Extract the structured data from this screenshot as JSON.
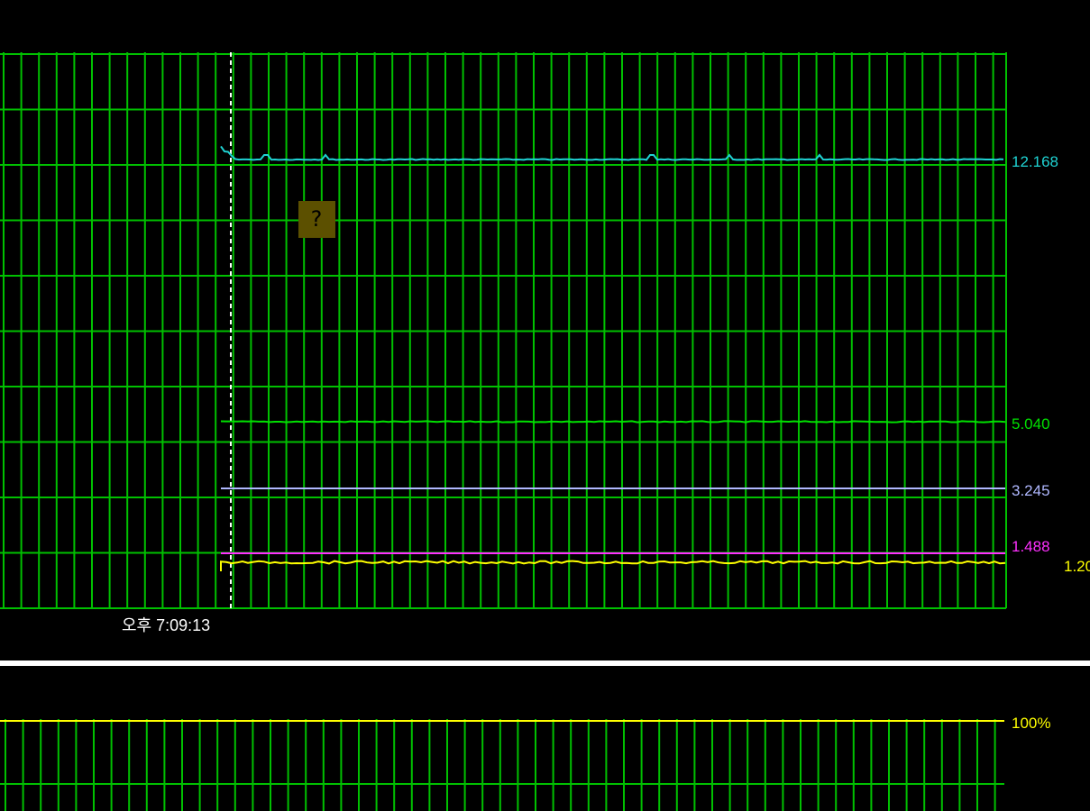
{
  "chart_data": [
    {
      "type": "line",
      "title": "",
      "xlabel": "",
      "ylabel": "",
      "grid": true,
      "grid_color": "#00c000",
      "background": "#000000",
      "time_label": "오후 7:09:13",
      "series": [
        {
          "value_label": "12.168",
          "color": "#1fd3d3",
          "values": [
            12.168
          ]
        },
        {
          "value_label": "5.040",
          "color": "#00e000",
          "values": [
            5.04
          ]
        },
        {
          "value_label": "3.245",
          "color": "#b0b8ff",
          "values": [
            3.245
          ]
        },
        {
          "value_label": "1.488",
          "color": "#ff30ff",
          "values": [
            1.488
          ]
        },
        {
          "value_label": "1.20",
          "color": "#ffff00",
          "values": [
            1.2
          ]
        }
      ]
    },
    {
      "type": "line",
      "title": "",
      "grid": true,
      "grid_color": "#00c000",
      "background": "#000000",
      "series": [
        {
          "value_label": "100%",
          "color": "#ffff00",
          "values": [
            100
          ]
        }
      ]
    }
  ],
  "icons": {
    "indicator": "warning-badge-icon",
    "indicator_color": "#5c5000"
  },
  "divider_color": "#ffffff"
}
